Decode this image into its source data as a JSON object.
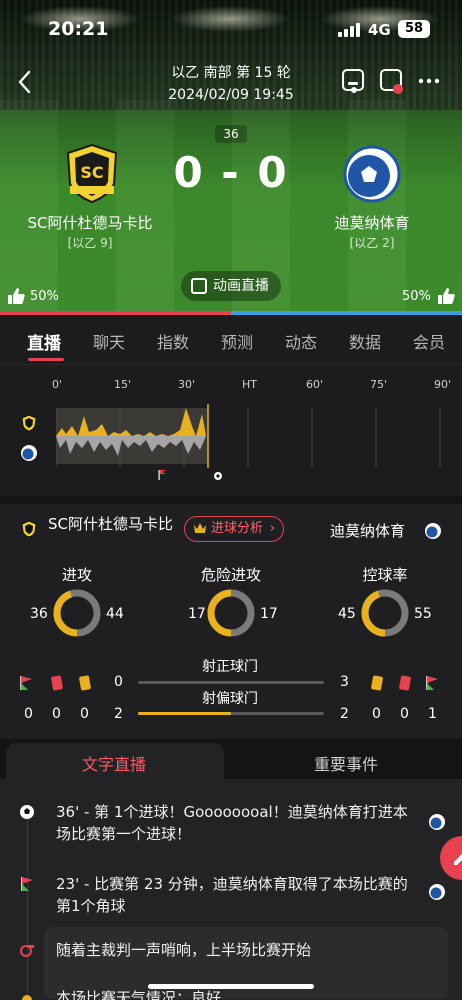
{
  "status_bar": {
    "time": "20:21",
    "network": "4G",
    "battery": "58"
  },
  "header": {
    "league": "以乙 南部 第 15 轮",
    "datetime": "2024/02/09 19:45",
    "minute": "36",
    "score": "0 - 0",
    "home": {
      "name": "SC阿什杜德马卡比",
      "rank": "[以乙 9]",
      "vote": "50%"
    },
    "away": {
      "name": "迪莫纳体育",
      "rank": "[以乙 2]",
      "vote": "50%"
    },
    "anim_label": "动画直播",
    "vote_split": 0.5
  },
  "tabs": [
    "直播",
    "聊天",
    "指数",
    "预测",
    "动态",
    "数据",
    "会员"
  ],
  "timeline": {
    "ticks": [
      "0'",
      "15'",
      "30'",
      "HT",
      "60'",
      "75'",
      "90'"
    ]
  },
  "stats": {
    "home_name": "SC阿什杜德马卡比",
    "away_name": "迪莫纳体育",
    "goal_analysis": "进球分析",
    "metrics": [
      {
        "label": "进攻",
        "home": "36",
        "away": "44"
      },
      {
        "label": "危险进攻",
        "home": "17",
        "away": "17"
      },
      {
        "label": "控球率",
        "home": "45",
        "away": "55"
      }
    ],
    "shots_on": {
      "label": "射正球门",
      "home": "0",
      "away": "3"
    },
    "shots_off": {
      "label": "射偏球门",
      "home": "2",
      "away": "2"
    },
    "home_cards": {
      "corners": "0",
      "red": "0",
      "yellow": "0"
    },
    "away_cards": {
      "yellow": "0",
      "red": "0",
      "corners": "1"
    }
  },
  "lower_tabs": {
    "active": "文字直播",
    "other": "重要事件"
  },
  "feed": [
    {
      "text": "36' - 第 1个进球！Goooooooal！迪莫纳体育打进本场比赛第一个进球！",
      "icon": "ball-icon"
    },
    {
      "text": "23' - 比赛第 23 分钟，迪莫纳体育取得了本场比赛的第1个角球",
      "icon": "corner-flag-icon"
    },
    {
      "text": "随着主裁判一声哨响，上半场比赛开始",
      "icon": "whistle-icon"
    },
    {
      "text": "本场比赛天气情况：良好",
      "icon": "weather-icon"
    }
  ],
  "colors": {
    "accent": "#e8414f",
    "home_bar": "#e9b11d",
    "away": "#3f9be6"
  }
}
